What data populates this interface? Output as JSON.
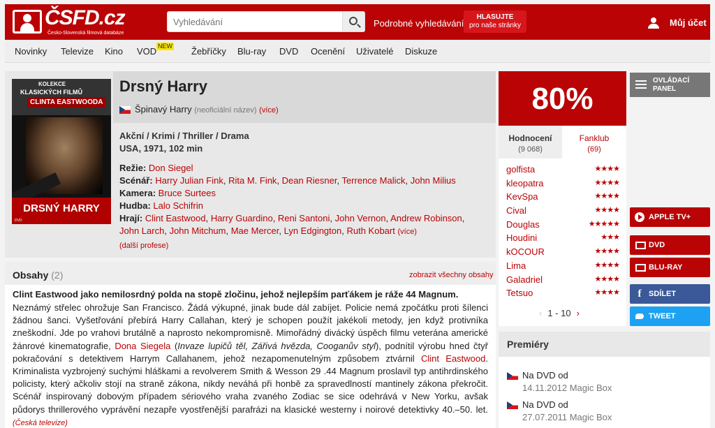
{
  "header": {
    "logo_text": "ČSFD.cz",
    "logo_subtitle": "Česko-Slovenská filmová databáze",
    "search_placeholder": "Vyhledávání",
    "advanced_search": "Podrobné vyhledávání",
    "vote_title": "HLASUJTE",
    "vote_subtitle": "pro naše stránky",
    "account": "Můj účet",
    "brand_color": "#ba0305"
  },
  "nav": {
    "items": [
      "Novinky",
      "Televize",
      "Kino",
      "VOD",
      "Žebříčky",
      "Blu-ray",
      "DVD",
      "Ocenění",
      "Uživatelé",
      "Diskuze"
    ],
    "vod_badge": "NEW"
  },
  "poster": {
    "line1": "KOLEKCE",
    "line2": "KLASICKÝCH FILMŮ",
    "line3": "CLINTA EASTWOODA",
    "title": "DRSNÝ HARRY",
    "small": "DVD"
  },
  "film": {
    "title": "Drsný Harry",
    "alt_title": "Špinavý Harry",
    "alt_note": "(neoficiální název)",
    "alt_more": "(více)",
    "genres": "Akční / Krimi / Thriller / Drama",
    "origin": "USA, 1971, 102 min",
    "directing_label": "Režie:",
    "directing": [
      "Don Siegel"
    ],
    "screenplay_label": "Scénář:",
    "screenplay": [
      "Harry Julian Fink",
      "Rita M. Fink",
      "Dean Riesner",
      "Terrence Malick",
      "John Milius"
    ],
    "camera_label": "Kamera:",
    "camera": [
      "Bruce Surtees"
    ],
    "music_label": "Hudba:",
    "music": [
      "Lalo Schifrin"
    ],
    "cast_label": "Hrají:",
    "cast": [
      "Clint Eastwood",
      "Harry Guardino",
      "Reni Santoni",
      "John Vernon",
      "Andrew Robinson",
      "John Larch",
      "John Mitchum",
      "Mae Mercer",
      "Lyn Edgington",
      "Ruth Kobart"
    ],
    "cast_more": "(více)",
    "more_professions": "(další profese)"
  },
  "plot": {
    "heading": "Obsahy",
    "count": "(2)",
    "show_all": "zobrazit všechny obsahy",
    "lead": "Clint Eastwood jako nemilosrdný polda na stopě zločinu, jehož nejlepším parťákem je ráže 44 Magnum.",
    "p1": "Neznámý střelec ohrožuje San Francisco. Žádá výkupné, jinak bude dál zabíjet. Policie nemá zpočátku proti šílenci žádnou šanci. Vyšetřování přebírá Harry Callahan, který je schopen použít jakékoli metody, jen když protivníka zneškodní. Jde po vrahovi brutálně a naprosto nekompromisně. Mimořádný divácký úspěch filmu veterána americké žánrové kinematografie,",
    "director_link": "Dona Siegela",
    "p2_open": "(",
    "other_films": "Invaze lupičů těl, Zářivá hvězda, Cooganův styl",
    "p2_close": "), podnítil výrobu hned čtyř pokračování s detektivem Harrym Callahanem, jehož nezapomenutelným způsobem ztvárnil",
    "actor_link": "Clint Eastwood",
    "p3": ". Kriminalista vyzbrojený suchými hláškami a revolverem Smith & Wesson 29 .44 Magnum proslavil typ antihrdinského policisty, který ačkoliv stojí na straně zákona, nikdy neváhá při honbě za spravedlností mantinely zákona překročit. Scénář inspirovaný dobovým případem sériového vraha zvaného Zodiac se sice odehrává v New Yorku, avšak půdorys thrillerového vyprávění nezapře vyostřenější parafrázi na klasické westerny i noirové detektivky 40.–50. let.",
    "source": "(Česká televize)"
  },
  "rating": {
    "score": "80%",
    "tab_ratings": "Hodnocení",
    "ratings_count": "(9 068)",
    "tab_fanclub": "Fanklub",
    "fanclub_count": "(69)",
    "users": [
      {
        "name": "golfista",
        "stars": "★★★★"
      },
      {
        "name": "kleopatra",
        "stars": "★★★★"
      },
      {
        "name": "KevSpa",
        "stars": "★★★★"
      },
      {
        "name": "Cival",
        "stars": "★★★★"
      },
      {
        "name": "Douglas",
        "stars": "★★★★★"
      },
      {
        "name": "Houdini",
        "stars": "★★★"
      },
      {
        "name": "kOCOUR",
        "stars": "★★★★"
      },
      {
        "name": "Lima",
        "stars": "★★★★"
      },
      {
        "name": "Galadriel",
        "stars": "★★★★"
      },
      {
        "name": "Tetsuo",
        "stars": "★★★★"
      }
    ],
    "pager": "1 - 10"
  },
  "sidebar": {
    "panel": "OVLÁDACÍ PANEL",
    "appletv": "APPLE TV+",
    "dvd": "DVD",
    "bluray": "BLU-RAY",
    "share": "SDÍLET",
    "tweet": "TWEET"
  },
  "premiere": {
    "heading": "Premiéry",
    "rows": [
      {
        "label": "Na DVD od",
        "date": "14.11.2012 Magic Box"
      },
      {
        "label": "Na DVD od",
        "date": "27.07.2011 Magic Box"
      }
    ]
  }
}
